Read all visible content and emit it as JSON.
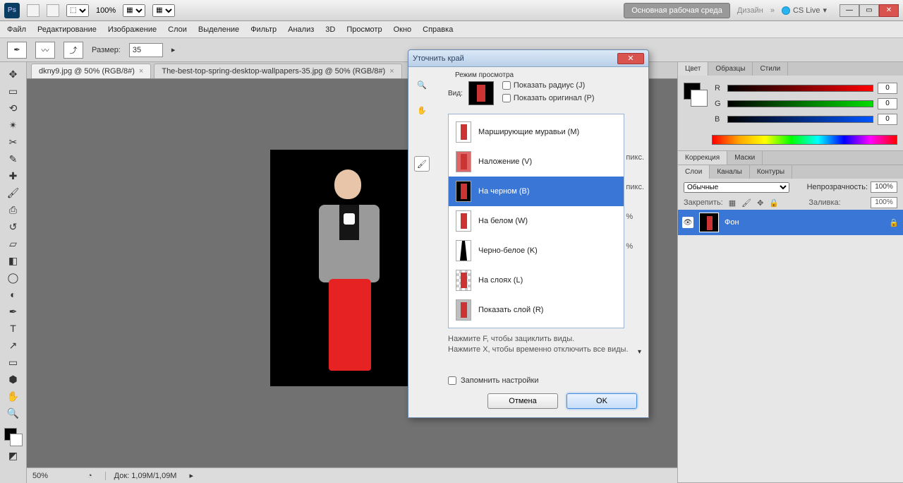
{
  "menubar": {
    "workspace_btn": "Основная рабочая среда",
    "design": "Дизайн",
    "cs_live": "CS Live",
    "zoom_pct": "100%"
  },
  "mainmenu": [
    "Файл",
    "Редактирование",
    "Изображение",
    "Слои",
    "Выделение",
    "Фильтр",
    "Анализ",
    "3D",
    "Просмотр",
    "Окно",
    "Справка"
  ],
  "options": {
    "size_label": "Размер:",
    "size_value": "35"
  },
  "tabs": [
    {
      "label": "dkny9.jpg @ 50% (RGB/8#)",
      "active": true
    },
    {
      "label": "The-best-top-spring-desktop-wallpapers-35.jpg @ 50% (RGB/8#)",
      "active": false
    }
  ],
  "status": {
    "zoom": "50%",
    "doc": "Док: 1,09M/1,09M"
  },
  "panels": {
    "color_tabs": [
      "Цвет",
      "Образцы",
      "Стили"
    ],
    "rgb": {
      "r": "0",
      "g": "0",
      "b": "0"
    },
    "adjust_tabs": [
      "Коррекция",
      "Маски"
    ],
    "layer_tabs": [
      "Слои",
      "Каналы",
      "Контуры"
    ],
    "blend_mode": "Обычные",
    "opacity_label": "Непрозрачность:",
    "opacity": "100%",
    "lock_label": "Закрепить:",
    "fill_label": "Заливка:",
    "fill": "100%",
    "layer_name": "Фон"
  },
  "dialog": {
    "title": "Уточнить край",
    "section_view": "Режим просмотра",
    "view_label": "Вид:",
    "show_radius": "Показать радиус (J)",
    "show_original": "Показать оригинал (P)",
    "items": [
      "Марширующие муравьи (M)",
      "Наложение (V)",
      "На черном (B)",
      "На белом (W)",
      "Черно-белое (K)",
      "На слоях (L)",
      "Показать слой (R)"
    ],
    "hint1": "Нажмите F, чтобы зациклить виды.",
    "hint2": "Нажмите X, чтобы временно отключить все виды.",
    "side1": "пикс.",
    "side2": "пикс.",
    "side3": "%",
    "side4": "%",
    "remember": "Запомнить настройки",
    "cancel": "Отмена",
    "ok": "OK"
  }
}
